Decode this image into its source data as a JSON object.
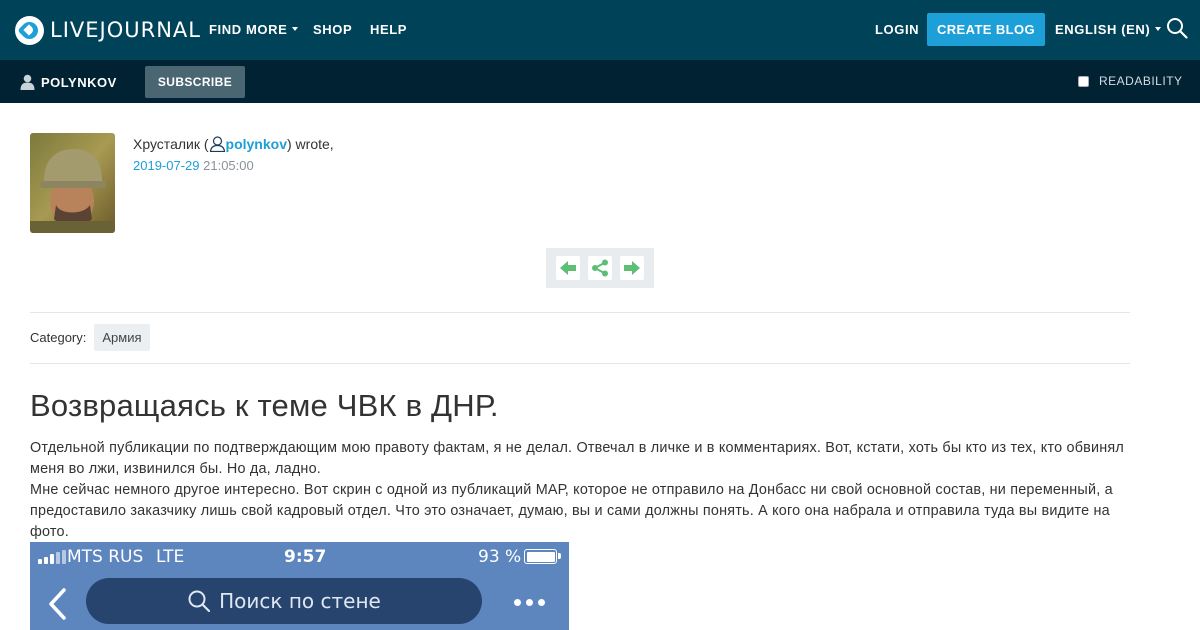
{
  "header": {
    "logo_text": "LIVEJOURNAL",
    "nav": {
      "find_more": "FIND MORE",
      "shop": "SHOP",
      "help": "HELP",
      "login": "LOGIN",
      "create_blog": "CREATE BLOG",
      "language": "ENGLISH (EN)"
    },
    "search_icon": "search-icon"
  },
  "userbar": {
    "username": "POLYNKOV",
    "subscribe": "SUBSCRIBE",
    "readability": "READABILITY",
    "readability_checked": false
  },
  "entry": {
    "poster_prefix": "Хрусталик (",
    "poster_user": "polynkov",
    "poster_suffix": ") wrote,",
    "date": "2019-07-29",
    "time": "21:05:00",
    "controls": [
      "prev-arrow-icon",
      "share-icon",
      "next-arrow-icon"
    ],
    "category_label": "Category:",
    "category_tag": "Армия",
    "title": "Возвращаясь к теме ЧВК в ДНР.",
    "paragraph_1": "Отдельной публикации по подтверждающим мою правоту фактам, я не делал. Отвечал в личке и в комментариях. Вот, кстати, хоть бы кто из тех, кто обвинял меня во лжи, извинился бы. Но да, ладно.",
    "paragraph_2": "Мне сейчас немного другое интересно. Вот скрин с одной из публикаций МАР, которое не отправило на Донбасс ни свой основной состав, ни переменный, а предоставило заказчику лишь свой кадровый отдел. Что это означает, думаю, вы и сами должны понять. А кого она набрала и отправила туда вы видите на фото."
  },
  "phone": {
    "carrier": "MTS RUS",
    "network": "LTE",
    "clock": "9:57",
    "battery": "93 %",
    "search_placeholder": "Поиск по стене"
  },
  "colors": {
    "topbar": "#004359",
    "userbar": "#002232",
    "accent": "#1d9fd8",
    "subscribe_button": "#4a6673",
    "control_arrows": "#5dbf74",
    "phone_header": "#5d86bf"
  }
}
